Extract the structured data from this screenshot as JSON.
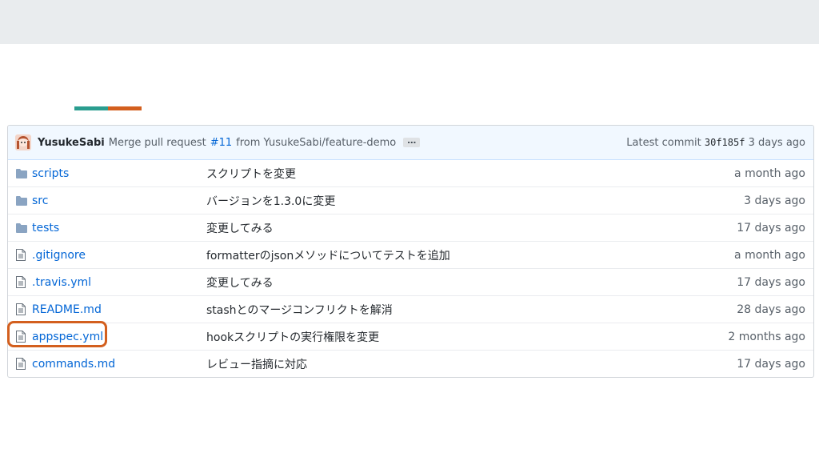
{
  "commit": {
    "author": "YusukeSabi",
    "message_prefix": "Merge pull request",
    "pr_link": "#11",
    "message_suffix": "from YusukeSabi/feature-demo",
    "ellipsis": "…",
    "latest_label": "Latest commit",
    "sha": "30f185f",
    "age": "3 days ago"
  },
  "files": [
    {
      "type": "folder",
      "icon": "folder-icon",
      "name": "scripts",
      "message": "スクリプトを変更",
      "age": "a month ago"
    },
    {
      "type": "folder",
      "icon": "folder-icon",
      "name": "src",
      "message": "バージョンを1.3.0に変更",
      "age": "3 days ago"
    },
    {
      "type": "folder",
      "icon": "folder-icon",
      "name": "tests",
      "message": "変更してみる",
      "age": "17 days ago"
    },
    {
      "type": "file",
      "icon": "file-icon",
      "name": ".gitignore",
      "message": "formatterのjsonメソッドについてテストを追加",
      "age": "a month ago"
    },
    {
      "type": "file",
      "icon": "file-icon",
      "name": ".travis.yml",
      "message": "変更してみる",
      "age": "17 days ago"
    },
    {
      "type": "file",
      "icon": "file-icon",
      "name": "README.md",
      "message": "stashとのマージコンフリクトを解消",
      "age": "28 days ago"
    },
    {
      "type": "file",
      "icon": "file-icon",
      "name": "appspec.yml",
      "message": "hookスクリプトの実行権限を変更",
      "age": "2 months ago"
    },
    {
      "type": "file",
      "icon": "file-icon",
      "name": "commands.md",
      "message": "レビュー指摘に対応",
      "age": "17 days ago"
    }
  ],
  "colors": {
    "accent_teal": "#2a9d8f",
    "accent_orange": "#d35f1e",
    "link_blue": "#0366d6",
    "folder_gray": "#79b8ff"
  }
}
